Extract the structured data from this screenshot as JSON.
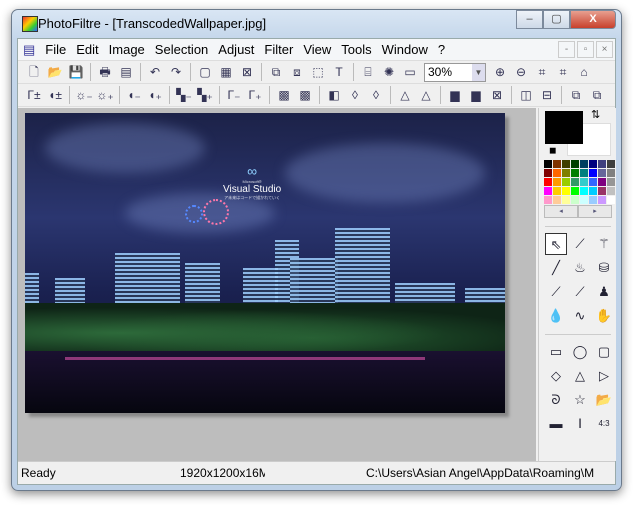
{
  "window": {
    "title": "PhotoFiltre - [TranscodedWallpaper.jpg]",
    "minimize": "–",
    "maximize": "▢",
    "close": "X"
  },
  "menu": [
    "File",
    "Edit",
    "Image",
    "Selection",
    "Adjust",
    "Filter",
    "View",
    "Tools",
    "Window",
    "?"
  ],
  "mdi": {
    "minimize": "-",
    "restore": "▫",
    "close": "×"
  },
  "zoom": {
    "value": "30%"
  },
  "toolbar1": [
    {
      "n": "new-icon",
      "g": "🗋"
    },
    {
      "n": "open-icon",
      "g": "📂"
    },
    {
      "n": "save-icon",
      "g": "💾"
    },
    {
      "n": "sep"
    },
    {
      "n": "print-icon",
      "g": "🖶"
    },
    {
      "n": "scan-icon",
      "g": "▤"
    },
    {
      "n": "sep"
    },
    {
      "n": "undo-icon",
      "g": "↶"
    },
    {
      "n": "redo-icon",
      "g": "↷"
    },
    {
      "n": "sep"
    },
    {
      "n": "grayscale-icon",
      "g": "▢"
    },
    {
      "n": "colors-icon",
      "g": "▦"
    },
    {
      "n": "fx-icon",
      "g": "⊠"
    },
    {
      "n": "sep"
    },
    {
      "n": "copy-image-icon",
      "g": "⧉"
    },
    {
      "n": "paste-image-icon",
      "g": "⧈"
    },
    {
      "n": "selection-icon",
      "g": "⬚"
    },
    {
      "n": "text-icon",
      "g": "T"
    },
    {
      "n": "sep"
    },
    {
      "n": "explorer-icon",
      "g": "⌸"
    },
    {
      "n": "plugin-icon",
      "g": "✺"
    },
    {
      "n": "window-icon",
      "g": "▭"
    },
    {
      "n": "zoomsel"
    },
    {
      "n": "zoom-in-icon",
      "g": "⊕"
    },
    {
      "n": "zoom-out-icon",
      "g": "⊖"
    },
    {
      "n": "actual-size-icon",
      "g": "⌗"
    },
    {
      "n": "fit-icon",
      "g": "⌗"
    },
    {
      "n": "fullscreen-icon",
      "g": "⌂"
    }
  ],
  "toolbar2": [
    {
      "n": "auto-levels-icon",
      "g": "Γ±"
    },
    {
      "n": "auto-contrast-icon",
      "g": "◖±"
    },
    {
      "n": "sep"
    },
    {
      "n": "brightness-minus-icon",
      "g": "☼₋"
    },
    {
      "n": "brightness-plus-icon",
      "g": "☼₊"
    },
    {
      "n": "sep"
    },
    {
      "n": "contrast-minus-icon",
      "g": "◖₋"
    },
    {
      "n": "contrast-plus-icon",
      "g": "◖₊"
    },
    {
      "n": "sep"
    },
    {
      "n": "saturation-minus-icon",
      "g": "▚₋"
    },
    {
      "n": "saturation-plus-icon",
      "g": "▚₊"
    },
    {
      "n": "sep"
    },
    {
      "n": "gamma-minus-icon",
      "g": "Γ₋"
    },
    {
      "n": "gamma-plus-icon",
      "g": "Γ₊"
    },
    {
      "n": "sep"
    },
    {
      "n": "filter-icon",
      "g": "▩"
    },
    {
      "n": "filter2-icon",
      "g": "▩"
    },
    {
      "n": "sep"
    },
    {
      "n": "blur-icon",
      "g": "◧"
    },
    {
      "n": "soften-icon",
      "g": "◊"
    },
    {
      "n": "soften-more-icon",
      "g": "◊"
    },
    {
      "n": "sep"
    },
    {
      "n": "sharpen-icon",
      "g": "△"
    },
    {
      "n": "sharpen-more-icon",
      "g": "△"
    },
    {
      "n": "sep"
    },
    {
      "n": "gradient-icon",
      "g": "▆"
    },
    {
      "n": "gradient2-icon",
      "g": "▆"
    },
    {
      "n": "effect-icon",
      "g": "⊠"
    },
    {
      "n": "sep"
    },
    {
      "n": "flip-horizontal-icon",
      "g": "◫"
    },
    {
      "n": "flip-vertical-icon",
      "g": "⊟"
    },
    {
      "n": "sep"
    },
    {
      "n": "rotate-icon",
      "g": "⧉"
    },
    {
      "n": "rotate2-icon",
      "g": "⧉"
    }
  ],
  "palette": [
    "#000000",
    "#7f3300",
    "#3f3f00",
    "#003f00",
    "#003f5f",
    "#00007f",
    "#3f3f7f",
    "#3f3f3f",
    "#7f0000",
    "#ff6600",
    "#7f7f00",
    "#007f00",
    "#007f7f",
    "#0000ff",
    "#66669a",
    "#808080",
    "#ff0000",
    "#ff9900",
    "#99cc00",
    "#339966",
    "#33cccc",
    "#3366ff",
    "#7f007f",
    "#969696",
    "#ff00ff",
    "#ffcc00",
    "#ffff00",
    "#00ff00",
    "#00ffff",
    "#00ccff",
    "#993366",
    "#c0c0c0",
    "#ff99cc",
    "#ffcc99",
    "#ffff99",
    "#ccffcc",
    "#ccffff",
    "#99ccff",
    "#cc99ff",
    "#ffffff"
  ],
  "tools1": [
    {
      "n": "select-tool-icon",
      "g": "⇖"
    },
    {
      "n": "eyedropper-tool-icon",
      "g": "⟋"
    },
    {
      "n": "magic-wand-tool-icon",
      "g": "⚚"
    },
    {
      "n": "line-tool-icon",
      "g": "╱"
    },
    {
      "n": "fill-tool-icon",
      "g": "♨"
    },
    {
      "n": "spray-tool-icon",
      "g": "⛁"
    },
    {
      "n": "brush-tool-icon",
      "g": "⟋"
    },
    {
      "n": "advanced-brush-tool-icon",
      "g": "⟋"
    },
    {
      "n": "stamp-tool-icon",
      "g": "♟"
    },
    {
      "n": "blur-tool-icon",
      "g": "💧"
    },
    {
      "n": "smudge-tool-icon",
      "g": "∿"
    },
    {
      "n": "hand-tool-icon",
      "g": "✋"
    }
  ],
  "tools2": [
    {
      "n": "rectangle-icon",
      "g": "▭"
    },
    {
      "n": "ellipse-icon",
      "g": "◯"
    },
    {
      "n": "rounded-rect-icon",
      "g": "▢"
    },
    {
      "n": "diamond-icon",
      "g": "◇"
    },
    {
      "n": "triangle-icon",
      "g": "△"
    },
    {
      "n": "triangle-right-icon",
      "g": "▷"
    },
    {
      "n": "lasso-icon",
      "g": "ᘐ"
    },
    {
      "n": "polygon-icon",
      "g": "☆"
    },
    {
      "n": "open-shape-icon",
      "g": "📂"
    },
    {
      "n": "fill-option-icon",
      "g": "▬"
    },
    {
      "n": "height-option-icon",
      "g": "Ⅰ"
    },
    {
      "n": "ratio-option-icon",
      "g": "4:3"
    }
  ],
  "palette_nav": {
    "prev": "◂",
    "next": "▸"
  },
  "image": {
    "logo_text": "Visual Studio",
    "logo_small": "Microsoft®",
    "logo_tagline": "ア未来はコードで描かれていく"
  },
  "status": {
    "state": "Ready",
    "dimensions": "1920x1200x16M",
    "path": "C:\\Users\\Asian Angel\\AppData\\Roaming\\M"
  }
}
